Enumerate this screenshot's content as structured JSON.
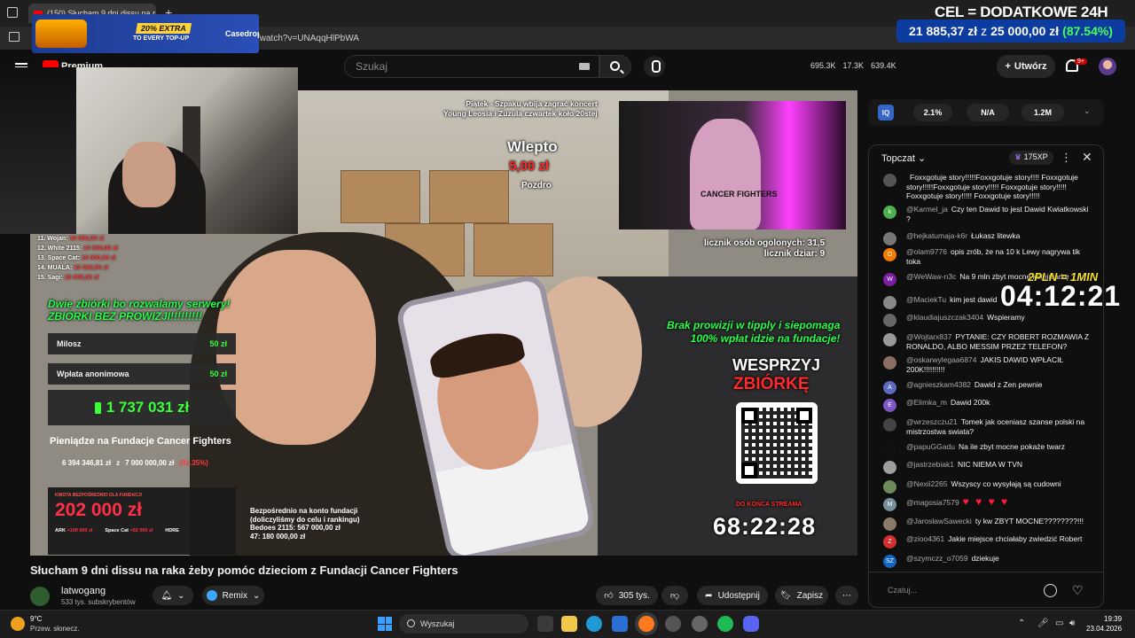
{
  "browser": {
    "tab_title": "(150) Słucham 9 dni dissu na ra",
    "url": "/watch?v=UNAqqHlPbWA"
  },
  "promo": {
    "extra": "20% EXTRA",
    "sub": "TO EVERY TOP-UP",
    "brand": "Casedrop"
  },
  "goal": {
    "title": "CEL = DODATKOWE 24H",
    "current": "21 885,37 zł",
    "of": "z",
    "target": "25 000,00 zł",
    "percent": "(87.54%)"
  },
  "youtube": {
    "logo_text": "Premium",
    "country": "PL",
    "filters_label": "Filters",
    "search_placeholder": "Szukaj",
    "stats": [
      "695.3K",
      "17.3K",
      "639.4K"
    ],
    "create_label": "Utwórz",
    "notif_count": "9+"
  },
  "stream_overlay": {
    "concert_line1": "Piątek - Szpaku wbija zagrać koncert",
    "concert_line2": "Young Leosia i Zuzula czwartek koło 20stej",
    "concert_caption": "CANCER FIGHTERS",
    "tip_title": "Wlepto",
    "tip_amount": "5,00 zł",
    "tip_message": "Pozdro",
    "leaderboard": [
      {
        "name": "11. Wojan:",
        "amount": "10 000,00 zł"
      },
      {
        "name": "12. White 2115:",
        "amount": "10 000,00 zł"
      },
      {
        "name": "13. Space Cat:",
        "amount": "10 000,00 zł"
      },
      {
        "name": "14. MUALA:",
        "amount": "10 000,00 zł"
      },
      {
        "name": "15. Sagi:",
        "amount": "10 000,00 zł"
      }
    ],
    "counter_people": "licznik osób ogolonych: 31,5",
    "counter_tats": "licznik dziar: 9",
    "promo_green_1": "Dwie zbiórki bo rozwalamy serwery!",
    "promo_green_2": "ZBIÓRKI BEZ PROWIZJI!!!!!!!!!",
    "donations": [
      {
        "name": "Milosz",
        "amount": "50 zł"
      },
      {
        "name": "Wpłata anonimowa",
        "amount": "50 zł"
      }
    ],
    "total": "1 737 031 zł",
    "fund_title": "Pieniądze na Fundacje Cancer Fighters",
    "fund_current": "6 394 346,81 zł",
    "fund_of": "z",
    "fund_target": "7 000 000,00 zł",
    "fund_pct": "(91.35%)",
    "direct_label": "KWOTA BEZPOŚREDNIO DLA FUNDACJI",
    "direct_amount": "202 000 zł",
    "direct_subs": [
      {
        "name": "ARK",
        "amount": "+100 000 zł"
      },
      {
        "name": "Space Cat",
        "amount": "+52 000 zł"
      },
      {
        "name": "HDRE",
        "amount": ""
      }
    ],
    "konto_lines": [
      "Bezpośrednio na konto fundacji",
      "(doliczyliśmy do celu i rankingu)",
      "Bedoes 2115: 567 000,00 zł",
      "47: 180 000,00 zł"
    ],
    "no_fee_1": "Brak prowizji w tipply i siepomaga",
    "no_fee_2": "100% wpłat idzie na fundacje!",
    "support_1": "WESPRZYJ",
    "support_2": "ZBIÓRKĘ",
    "countdown_label": "DO KOŃCA STREAMA",
    "countdown": "68:22:28",
    "rate_label": "2PLN = 1MIN",
    "timer": "04:12:21"
  },
  "video": {
    "title": "Słucham 9 dni dissu na raka żeby pomóc dzieciom z Fundacji Cancer Fighters",
    "channel": "latwogang",
    "subscribers": "533 tys. subskrybentów",
    "remix_label": "Remix",
    "likes": "305 tys.",
    "share_label": "Udostępnij",
    "save_label": "Zapisz"
  },
  "chat_stats": {
    "badge": "IQ",
    "values": [
      "2.1%",
      "N/A",
      "1.2M"
    ]
  },
  "chat": {
    "title": "Topczat",
    "xp": "175XP",
    "input_placeholder": "Czatuj...",
    "messages": [
      {
        "user": "",
        "text": "Foxxgotuje story!!!!!Foxxgotuje story!!!! Foxxgotuje story!!!!!Foxxgotuje story!!!!! Foxxgotuje story!!!!! Foxxgotuje story!!!!! Foxxgotuje story!!!!!",
        "avatar": "",
        "color": "#555555"
      },
      {
        "user": "@Karmel_ja",
        "text": "Czy ten Dawid to jest Dawid Kwiatkowski ?",
        "avatar": "k",
        "color": "#4caf50"
      },
      {
        "user": "@hejkatumaja-k6r",
        "text": "Łukasz litewka",
        "avatar": "",
        "color": "#777777"
      },
      {
        "user": "@olam9776",
        "text": "opis zrób, że na 10 k Lewy nagrywa tik toka",
        "avatar": "O",
        "color": "#f57c00"
      },
      {
        "user": "@WeWaw-n3c",
        "text": "Na 9 mln zbyt mocne kominiarkę",
        "avatar": "W",
        "color": "#7b1fa2"
      },
      {
        "user": "@MaciekTu",
        "text": "kim jest dawid",
        "avatar": "",
        "color": "#888888"
      },
      {
        "user": "@klaudiajuszczak3404",
        "text": "Wspieramy",
        "avatar": "",
        "color": "#666666"
      },
      {
        "user": "@Wojtarx837",
        "text": "PYTANIE: CZY ROBERT ROZMAWIA Z RONALDO, ALBO MESSIM PRZEZ TELEFON?",
        "avatar": "",
        "color": "#999999"
      },
      {
        "user": "@oskarwylegaa6874",
        "text": "JAKIS DAWID WPŁACIŁ 200K!!!!!!!!!!",
        "avatar": "",
        "color": "#8d6e63"
      },
      {
        "user": "@agnieszkam4382",
        "text": "Dawid z Zen pewnie",
        "avatar": "A",
        "color": "#5c6bc0"
      },
      {
        "user": "@Elimka_m",
        "text": "Dawid 200k",
        "avatar": "E",
        "color": "#7e57c2"
      },
      {
        "user": "@wrzeszczu21",
        "text": "Tomek jak oceniasz szanse polski na mistrzostwa swiata?",
        "avatar": "",
        "color": "#444444"
      },
      {
        "user": "@papuGGadu",
        "text": "Na ile zbyt mocne pokaże twarz",
        "avatar": "",
        "color": "#111111"
      },
      {
        "user": "@jastrzebiak1",
        "text": "NIC NIEMA W TVN",
        "avatar": "",
        "color": "#9e9e9e"
      },
      {
        "user": "@Nexii2265",
        "text": "Wszyscy co wysyłają są cudowni",
        "avatar": "",
        "color": "#6d8b5a"
      },
      {
        "user": "@magosia7579",
        "text": "♥ ♥ ♥ ♥",
        "avatar": "M",
        "color": "#78909c"
      },
      {
        "user": "@JarosławSawecki",
        "text": "ty kw ZBYT MOCNE????????!!!",
        "avatar": "",
        "color": "#8a7a6a"
      },
      {
        "user": "@zioo4361",
        "text": "Jakie miejsce chciałaby zwiedzić Robert",
        "avatar": "Z",
        "color": "#d32f2f"
      },
      {
        "user": "@szymczz_o7059",
        "text": "dziekuje",
        "avatar": "SZ",
        "color": "#1565c0"
      }
    ]
  },
  "taskbar": {
    "temperature": "9°C",
    "weather": "Przew. słonecz.",
    "search_label": "Wyszukaj",
    "time": "19:39",
    "date": "23.04.2026"
  }
}
